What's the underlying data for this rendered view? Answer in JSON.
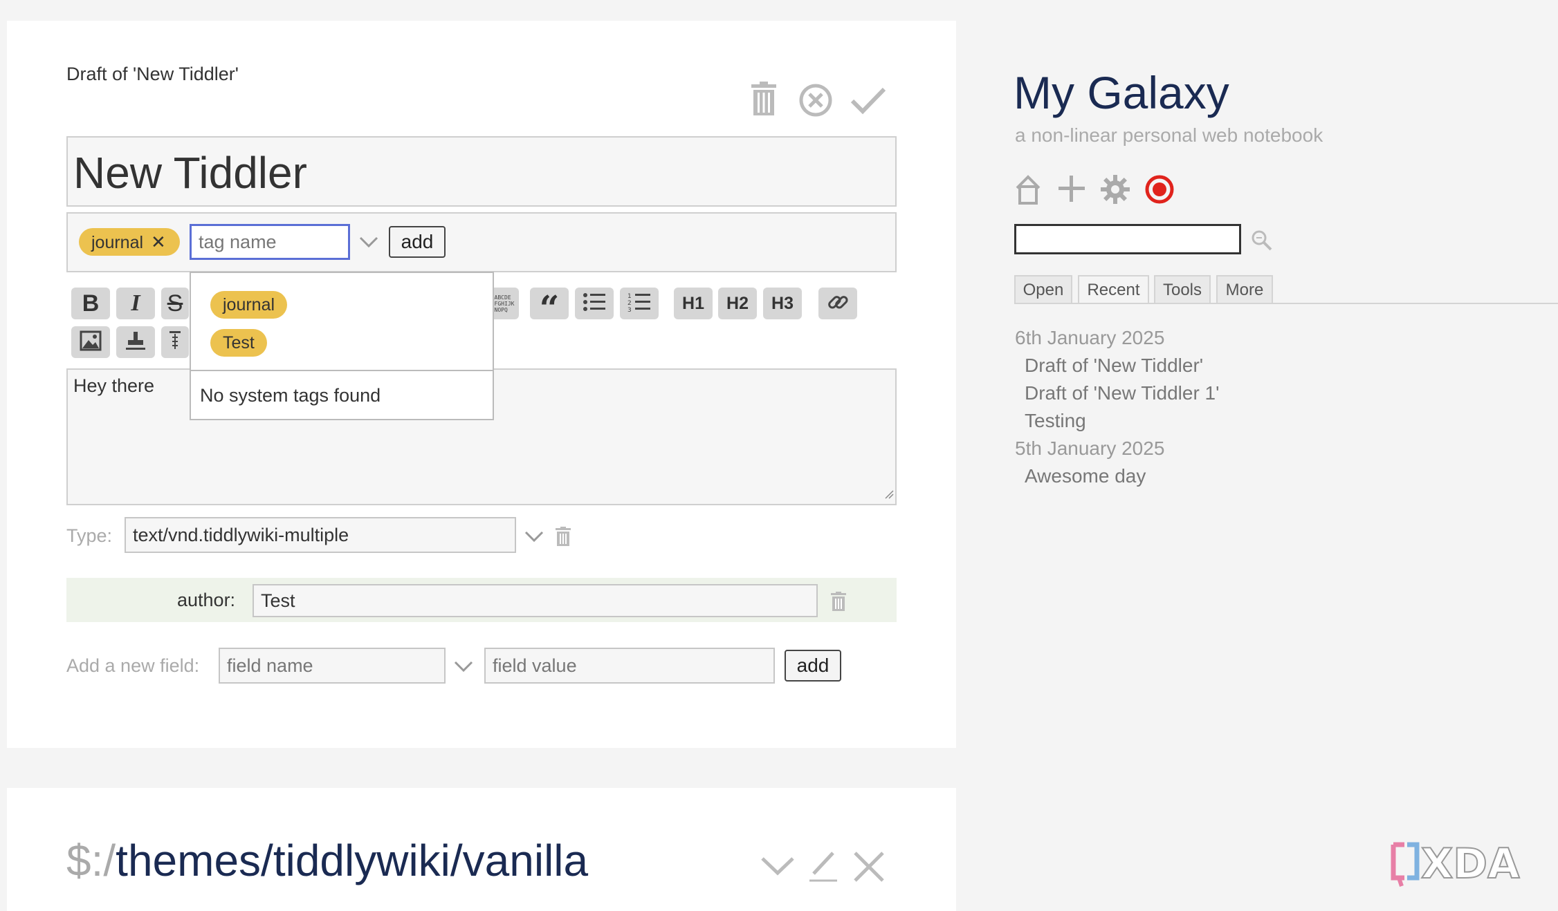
{
  "draft": {
    "heading": "Draft of 'New Tiddler'",
    "title_value": "New Tiddler",
    "tag_chip": "journal",
    "tag_input_placeholder": "tag name",
    "tag_add_label": "add",
    "tag_suggestions": [
      "journal",
      "Test"
    ],
    "no_system_tags": "No system tags found",
    "body_text": "Hey there",
    "type_label": "Type:",
    "type_value": "text/vnd.tiddlywiki-multiple",
    "field_name_label": "author:",
    "field_value": "Test",
    "new_field_label": "Add a new field:",
    "new_field_name_placeholder": "field name",
    "new_field_value_placeholder": "field value",
    "new_field_add_label": "add",
    "toolbar_headings": [
      "H1",
      "H2",
      "H3"
    ]
  },
  "second_tiddler": {
    "prefix": "$:/",
    "title": "themes/tiddlywiki/vanilla"
  },
  "sidebar": {
    "site_title": "My Galaxy",
    "site_subtitle": "a non-linear personal web notebook",
    "tabs": [
      "Open",
      "Recent",
      "Tools",
      "More"
    ],
    "active_tab": "Recent",
    "recent": {
      "date1": "6th January 2025",
      "date1_items": [
        "Draft of 'New Tiddler'",
        "Draft of 'New Tiddler 1'",
        "Testing"
      ],
      "date2": "5th January 2025",
      "date2_items": [
        "Awesome day"
      ]
    }
  },
  "watermark": {
    "brand": "XDA"
  },
  "colors": {
    "tag": "#ecc24f",
    "site_title": "#1a2a52",
    "record_icon": "#e0231c",
    "field_row_bg": "#eef3ea",
    "focus_border": "#5b6fd6"
  }
}
